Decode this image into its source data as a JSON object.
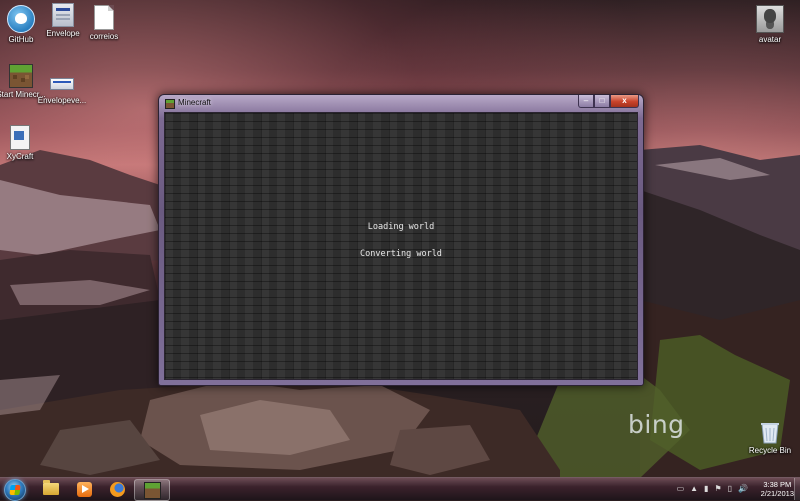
{
  "desktop": {
    "icons": [
      {
        "label": "GitHub",
        "icon": "github-icon"
      },
      {
        "label": "Envelope",
        "icon": "envelope-app-icon"
      },
      {
        "label": "correios",
        "icon": "document-icon"
      },
      {
        "label": "Start Minecr...",
        "icon": "minecraft-icon"
      },
      {
        "label": "Envelopeve...",
        "icon": "envelope-exe-icon"
      },
      {
        "label": "XyCraft",
        "icon": "xycraft-icon"
      },
      {
        "label": "avatar",
        "icon": "avatar-image-icon"
      },
      {
        "label": "Recycle Bin",
        "icon": "recycle-bin-icon"
      }
    ],
    "wallpaper_logo": "bing"
  },
  "window": {
    "title": "Minecraft",
    "controls": {
      "minimize": "–",
      "maximize": "□",
      "close": "x"
    },
    "status_lines": [
      "Loading world",
      "Converting world"
    ]
  },
  "taskbar": {
    "pinned": [
      {
        "name": "windows-explorer",
        "icon": "folder-icon"
      },
      {
        "name": "media-player",
        "icon": "media-play-icon"
      },
      {
        "name": "firefox",
        "icon": "firefox-icon"
      },
      {
        "name": "minecraft",
        "icon": "minecraft-icon",
        "active": true
      }
    ],
    "tray": {
      "up_arrow": "▲",
      "volume": "🔊"
    },
    "clock": {
      "time": "3:38 PM",
      "date": "2/21/2013"
    }
  },
  "colors": {
    "accent_window": "#7d6a93",
    "close_button": "#c9432b",
    "text_status": "#e8e8e8"
  }
}
